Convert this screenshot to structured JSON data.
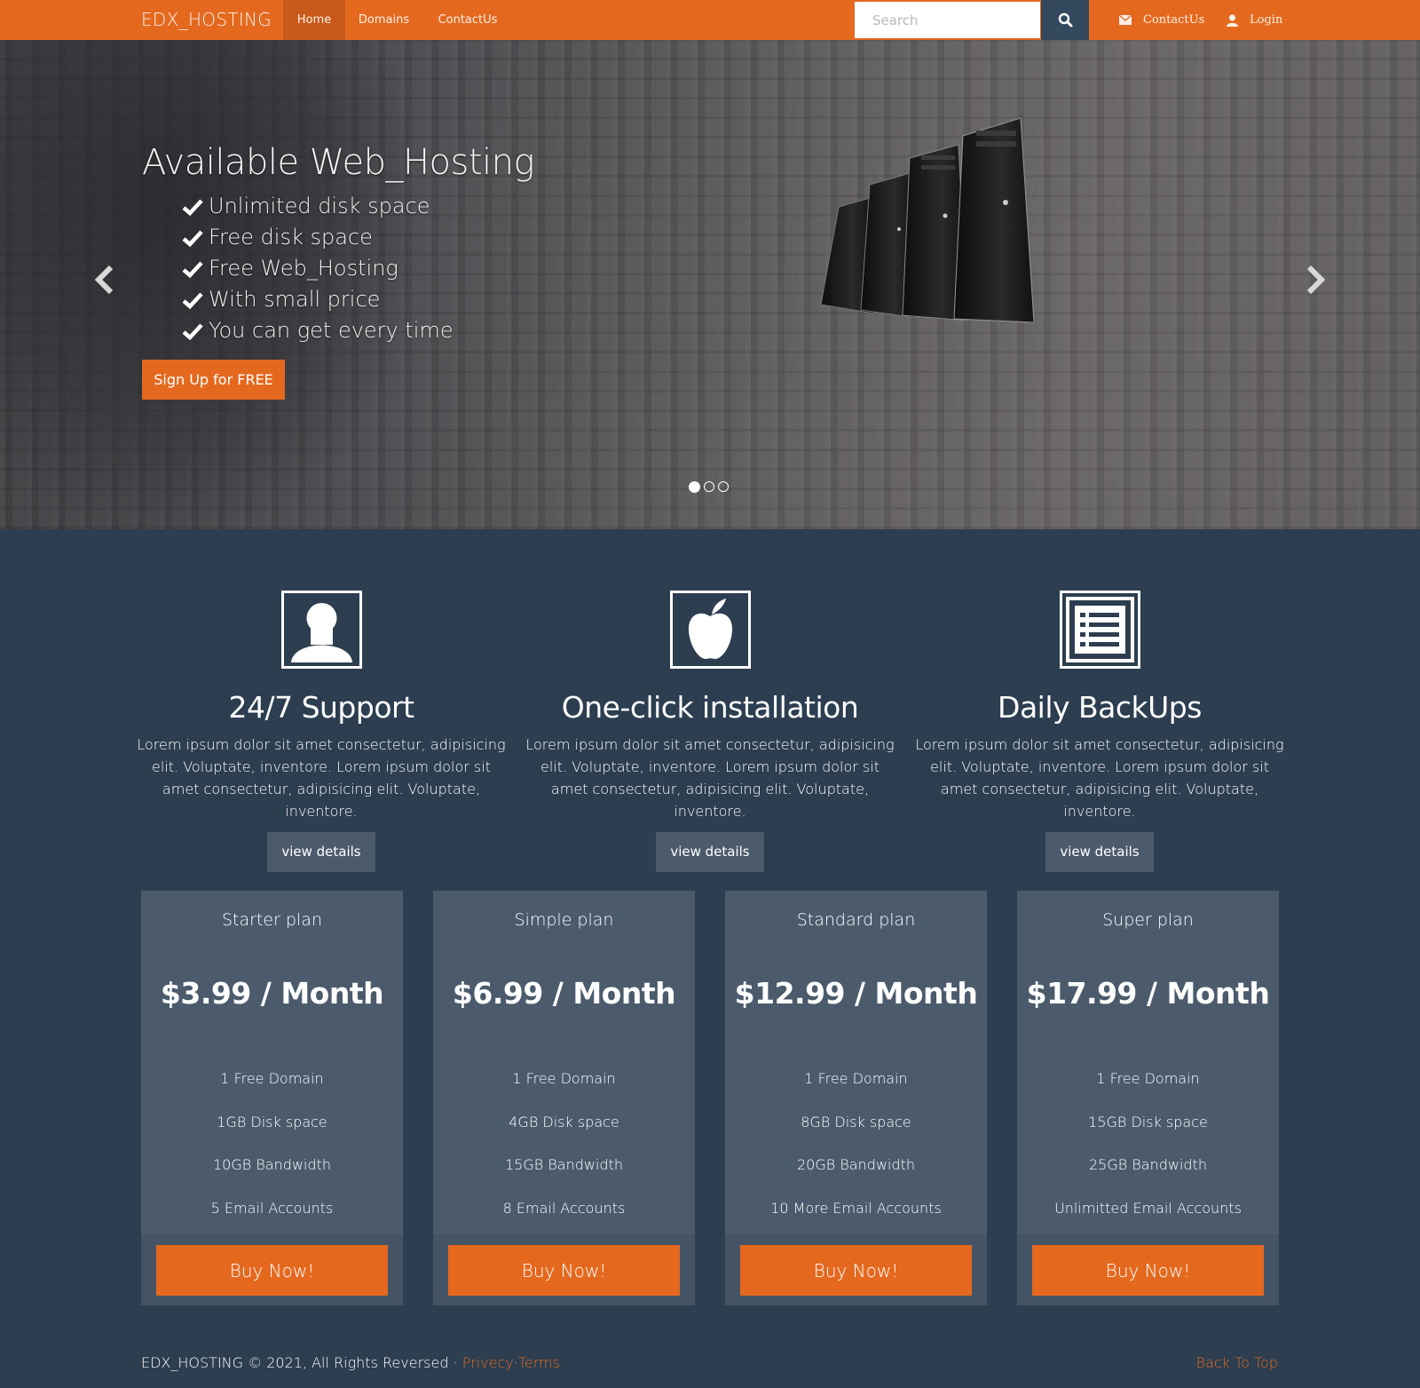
{
  "nav": {
    "brand": "EDX_HOSTING",
    "links": [
      {
        "label": "Home",
        "active": true
      },
      {
        "label": "Domains",
        "active": false
      },
      {
        "label": "ContactUs",
        "active": false
      }
    ],
    "search_placeholder": "Search",
    "right_links": [
      {
        "label": "ContactUs",
        "icon": "envelope-icon"
      },
      {
        "label": "Login",
        "icon": "user-icon"
      }
    ]
  },
  "hero": {
    "title": "Available Web_Hosting",
    "features": [
      "Unlimited disk space",
      "Free disk space",
      "Free Web_Hosting",
      "With small price",
      "You can get every time"
    ],
    "cta_label": "Sign Up for FREE",
    "slide_count": 3,
    "active_slide": 0
  },
  "features": [
    {
      "icon": "user-portrait-icon",
      "title": "24/7 Support",
      "text": "Lorem ipsum dolor sit amet consectetur, adipisicing elit. Voluptate, inventore. Lorem ipsum dolor sit amet consectetur, adipisicing elit. Voluptate, inventore.",
      "button": "view details"
    },
    {
      "icon": "apple-icon",
      "title": "One-click installation",
      "text": "Lorem ipsum dolor sit amet consectetur, adipisicing elit. Voluptate, inventore. Lorem ipsum dolor sit amet consectetur, adipisicing elit. Voluptate, inventore.",
      "button": "view details"
    },
    {
      "icon": "list-icon",
      "title": "Daily BackUps",
      "text": "Lorem ipsum dolor sit amet consectetur, adipisicing elit. Voluptate, inventore. Lorem ipsum dolor sit amet consectetur, adipisicing elit. Voluptate, inventore.",
      "button": "view details"
    }
  ],
  "plans": [
    {
      "name": "Starter plan",
      "price": "$3.99 / Month",
      "features": [
        "1 Free Domain",
        "1GB Disk space",
        "10GB Bandwidth",
        "5 Email Accounts"
      ],
      "button": "Buy Now!"
    },
    {
      "name": "Simple plan",
      "price": "$6.99 / Month",
      "features": [
        "1 Free Domain",
        "4GB Disk space",
        "15GB Bandwidth",
        "8 Email Accounts"
      ],
      "button": "Buy Now!"
    },
    {
      "name": "Standard plan",
      "price": "$12.99 / Month",
      "features": [
        "1 Free Domain",
        "8GB Disk space",
        "20GB Bandwidth",
        "10 More Email Accounts"
      ],
      "button": "Buy Now!"
    },
    {
      "name": "Super plan",
      "price": "$17.99 / Month",
      "features": [
        "1 Free Domain",
        "15GB Disk space",
        "25GB Bandwidth",
        "Unlimitted Email Accounts"
      ],
      "button": "Buy Now!"
    }
  ],
  "footer": {
    "copyright": "EDX_HOSTING © 2021, All Rights Reversed · ",
    "privacy": "Privecy",
    "separator": "·",
    "terms": "Terms",
    "back_to_top": "Back To Top"
  },
  "colors": {
    "accent": "#e4691f",
    "background": "#2c3e50",
    "card": "#4b5b6c"
  }
}
